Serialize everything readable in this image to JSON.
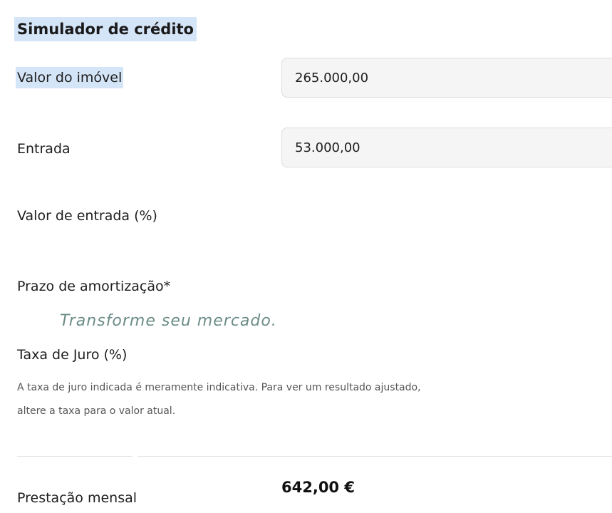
{
  "simulator": {
    "title": "Simulador de crédito",
    "property_value": {
      "label": "Valor do imóvel",
      "value": "265.000,00"
    },
    "down_payment": {
      "label": "Entrada",
      "value": "53.000,00"
    },
    "down_payment_pct": {
      "label": "Valor de entrada (%)"
    },
    "amortization_term": {
      "label": "Prazo de amortização*"
    },
    "watermark": "Transforme seu mercado.",
    "interest_rate": {
      "label": "Taxa de Juro (%)",
      "note_line1": "A taxa de juro indicada é meramente indicativa. Para ver um resultado ajustado,",
      "note_line2": "altere a taxa para o valor atual."
    },
    "monthly_payment": {
      "label": "Prestação mensal",
      "value": "642,00 €"
    }
  },
  "colors": {
    "highlight": "#d5e5f8",
    "field_bg": "#f5f5f6",
    "field_border": "#dcdcdf",
    "watermark": "#6b8c87"
  }
}
